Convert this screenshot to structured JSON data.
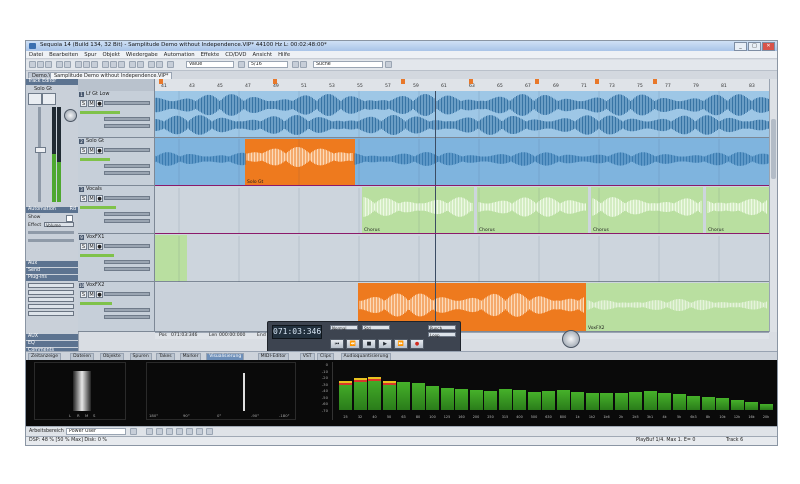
{
  "window": {
    "title": "Sequoia 14 (Build 134, 32 Bit) - Samplitude Demo without Independence.VIP*    44100 Hz L: 00:02:48:00*",
    "controls": [
      "_",
      "□",
      "✕"
    ]
  },
  "menu": [
    "Datei",
    "Bearbeiten",
    "Spur",
    "Objekt",
    "Wiedergabe",
    "Automation",
    "Effekte",
    "CD/DVD",
    "Ansicht",
    "Hilfe"
  ],
  "toolbar": {
    "combo1": "Value",
    "combo2": "5/16",
    "search": "Suche"
  },
  "doc_tabs": [
    "Demo.VIP",
    "Samplitude Demo without Independence.VIP*"
  ],
  "left_panel": {
    "track_editor": "Track Editor",
    "track_name": "Solo Gt",
    "automation": "Automation",
    "auto_label": "Rd",
    "show": "Show",
    "effect": "Effect",
    "effect_value": "Volume",
    "sections": [
      "Aux",
      "Send",
      "Plug-ins",
      "AUX",
      "EQ",
      "Comments"
    ]
  },
  "tracks": [
    {
      "num": "1",
      "name": "Lf Gt Low"
    },
    {
      "num": "2",
      "name": "Solo Gt"
    },
    {
      "num": "3",
      "name": "Vocals"
    },
    {
      "num": "9",
      "name": "VoxFX1"
    },
    {
      "num": "10",
      "name": "VoxFX2"
    }
  ],
  "ruler": [
    "41",
    "43",
    "45",
    "47",
    "49",
    "51",
    "53",
    "55",
    "57",
    "59",
    "61",
    "63",
    "65",
    "67",
    "69",
    "71",
    "73",
    "75",
    "77",
    "79",
    "81",
    "83"
  ],
  "clips": {
    "gt_low": "Lf Gt Lo",
    "solo": "Solo Gt",
    "chorus": "Chorus",
    "voxfx": "VoxFX2"
  },
  "status_row": {
    "pos_label": "Pos",
    "pos": "071:03:346",
    "len_label": "Len",
    "len": "000:00:000",
    "end_label": "End"
  },
  "transport": {
    "time": "071:03:346",
    "buttons": [
      "⏮",
      "⏪",
      "■",
      "▶",
      "⏩",
      "●"
    ],
    "sync": "Punch",
    "loop": "Loop",
    "mode": "Normal",
    "std": "Std"
  },
  "bottom_tabs": [
    "Zeitanzeige",
    "Dateien",
    "Objekte",
    "Spuren",
    "Takes",
    "Marker",
    "Visualisierung",
    "MIDI-Editor",
    "VST",
    "Clips",
    "Audioquantisierung"
  ],
  "viz": {
    "scope_labels": [
      "L",
      "R",
      "M",
      "S"
    ],
    "corr_labels": [
      "180°",
      "90°",
      "0°",
      "-90°",
      "-180°"
    ],
    "scale": [
      "0",
      "-10",
      "-20",
      "-30",
      "-40",
      "-50",
      "-60",
      "-70"
    ],
    "band_labels": [
      "25",
      "32",
      "40",
      "50",
      "63",
      "80",
      "100",
      "125",
      "160",
      "200",
      "250",
      "315",
      "400",
      "500",
      "630",
      "800",
      "1k",
      "1k2",
      "1k6",
      "2k",
      "2k5",
      "3k1",
      "4k",
      "5k",
      "6k3",
      "8k",
      "10k",
      "12k",
      "16k",
      "20k"
    ],
    "band_levels": [
      0.62,
      0.7,
      0.72,
      0.64,
      0.6,
      0.58,
      0.52,
      0.48,
      0.46,
      0.44,
      0.42,
      0.46,
      0.44,
      0.4,
      0.42,
      0.44,
      0.4,
      0.38,
      0.36,
      0.38,
      0.4,
      0.42,
      0.38,
      0.34,
      0.3,
      0.28,
      0.26,
      0.22,
      0.18,
      0.14
    ]
  },
  "workspace": {
    "label": "Arbeitsbereich",
    "value": "Power User"
  },
  "status": {
    "dsp": "DSP: 48 %  [50 % Max]   Disk:  0 %",
    "playbuf": "PlayBuf 1/4. Max 1. E= 0",
    "track": "Track 6"
  },
  "colors": {
    "clip_blue": "#5ea4d6",
    "clip_orange": "#ee7a1e",
    "clip_green": "#b9dfa0",
    "meter_green": "#3fa726",
    "selection": "#6d8fb9"
  }
}
